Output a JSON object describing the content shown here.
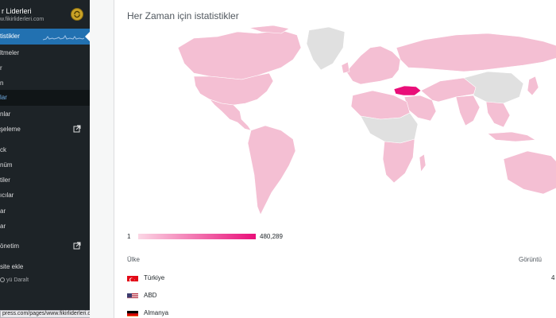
{
  "sidebar": {
    "site_name": "r Liderleri",
    "site_url": "w.fikirliderleri.com",
    "items": [
      {
        "label": "tistikler"
      },
      {
        "label": "ltmeler"
      },
      {
        "label": "r"
      },
      {
        "label": "n"
      },
      {
        "label": "lar"
      },
      {
        "label": "nlar"
      },
      {
        "label": "şeleme"
      },
      {
        "label": "ck"
      },
      {
        "label": "nüm"
      },
      {
        "label": "tiler"
      },
      {
        "label": "ıcılar"
      },
      {
        "label": "ar"
      },
      {
        "label": "ar"
      },
      {
        "label": "önetim"
      },
      {
        "label": "site ekle"
      }
    ],
    "collapse_label": "yü Daralt"
  },
  "status_bar": {
    "url": "press.com/pages/www.fikirliderleri.com"
  },
  "stats": {
    "title": "Her Zaman için istatistikler",
    "legend_min": "1",
    "legend_max": "480,289",
    "col_country": "Ülke",
    "col_views": "Görüntü",
    "rows": [
      {
        "name": "Türkiye",
        "value": "4",
        "flag": "turkey-flag-icon"
      },
      {
        "name": "ABD",
        "value": "",
        "flag": "usa-flag-icon"
      },
      {
        "name": "Almanya",
        "value": "",
        "flag": "germany-flag-icon"
      }
    ]
  },
  "colors": {
    "sidebar_bg": "#1d2327",
    "active_bg": "#2271b1",
    "map_pink": "#f4bfd3",
    "map_gray": "#e0e0e0",
    "highlight": "#e90f79"
  }
}
